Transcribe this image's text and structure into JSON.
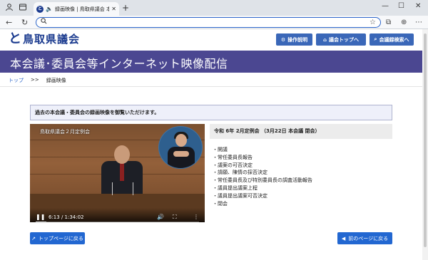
{
  "browser": {
    "tab_title": "録画映像 | 鳥取県議会 本会議",
    "tab_favicon_text": "と",
    "icons": [
      "profile-icon",
      "tab-actions-icon",
      "speaker-icon",
      "close-icon",
      "new-tab-icon",
      "minimize-icon",
      "maximize-icon",
      "window-close-icon",
      "back-icon",
      "reload-icon",
      "search-icon",
      "favorites-icon",
      "tabs-icon",
      "collections-icon",
      "extensions-icon",
      "more-icon"
    ],
    "address_value": ""
  },
  "site": {
    "logo_mark": "と",
    "logo_text": "鳥取県議会",
    "header_buttons": [
      {
        "icon": "gear-icon",
        "label": "操作説明"
      },
      {
        "icon": "home-icon",
        "label": "議会トップへ"
      },
      {
        "icon": "search-icon",
        "label": "会議録検索へ"
      }
    ],
    "banner_title": "本会議･委員会等インターネット映像配信",
    "breadcrumb": {
      "home": "トップ",
      "separator": ">>",
      "current": "録画映像"
    },
    "accent_color": "#4b4791",
    "button_color": "#2267d1"
  },
  "main": {
    "notice": "過去の本会議・委員会の録画映像を御覧いただけます。",
    "video": {
      "overlay_title": "鳥取県議会２月定例会",
      "time": "6:13 / 1:34:02",
      "progress": 0.066
    },
    "session_title": "令和 6年 2月定例会 （3月22日 本会議 閉会）",
    "agenda": [
      "開議",
      "常任委員長報告",
      "議案の可否決定",
      "請願、陳情の採否決定",
      "常任委員長及び特別委員長の調査活動報告",
      "議員提出議案上程",
      "議員提出議案可否決定",
      "閉会"
    ]
  },
  "footer": {
    "top_button": "トップページに戻る",
    "back_button": "前のページに戻る"
  }
}
